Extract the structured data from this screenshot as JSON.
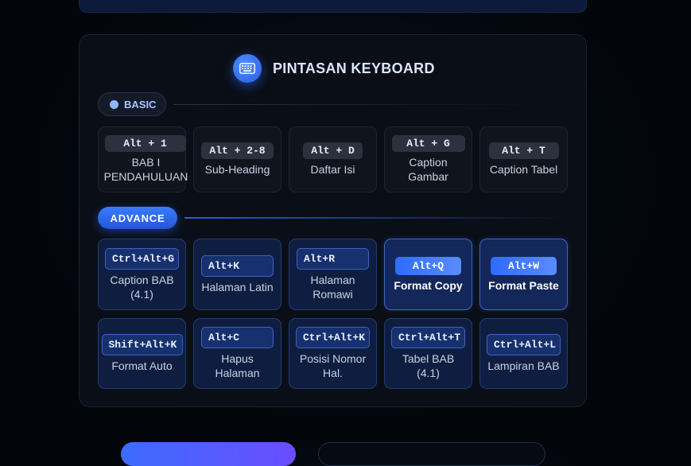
{
  "header": {
    "title": "PINTASAN KEYBOARD",
    "icon": "keyboard-icon"
  },
  "colors": {
    "accent": "#2f6bff",
    "panel_bg": "#0a0e16",
    "card_adv_bg": "#0f1d40"
  },
  "basic": {
    "label": "BASIC",
    "shortcuts": [
      {
        "key": "Alt + 1",
        "label": "BAB I PENDAHULUAN"
      },
      {
        "key": "Alt + 2-8",
        "label": "Sub-Heading"
      },
      {
        "key": "Alt + D",
        "label": "Daftar Isi"
      },
      {
        "key": "Alt + G",
        "label": "Caption Gambar"
      },
      {
        "key": "Alt + T",
        "label": "Caption Tabel"
      }
    ]
  },
  "advance": {
    "label": "ADVANCE",
    "row1": [
      {
        "key": "Ctrl+Alt+G",
        "label": "Caption BAB (4.1)"
      },
      {
        "key": "Alt+K",
        "label": "Halaman Latin"
      },
      {
        "key": "Alt+R",
        "label": "Halaman Romawi"
      },
      {
        "key": "Alt+Q",
        "label": "Format Copy"
      },
      {
        "key": "Alt+W",
        "label": "Format Paste"
      }
    ],
    "row2": [
      {
        "key": "Shift+Alt+K",
        "label": "Format Auto"
      },
      {
        "key": "Alt+C",
        "label": "Hapus Halaman"
      },
      {
        "key": "Ctrl+Alt+K",
        "label": "Posisi Nomor Hal."
      },
      {
        "key": "Ctrl+Alt+T",
        "label": "Tabel BAB (4.1)"
      },
      {
        "key": "Ctrl+Alt+L",
        "label": "Lampiran BAB"
      }
    ]
  }
}
